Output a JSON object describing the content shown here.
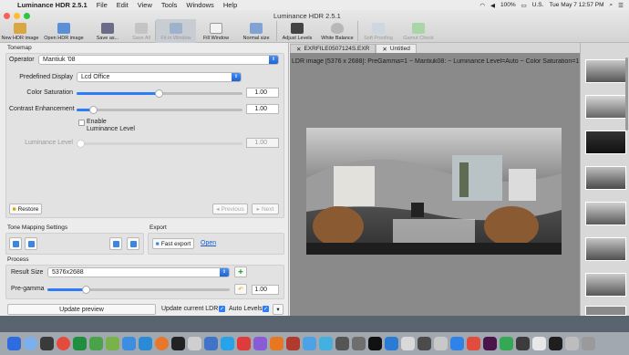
{
  "menubar": {
    "app": "Luminance HDR 2.5.1",
    "items": [
      "File",
      "Edit",
      "View",
      "Tools",
      "Windows",
      "Help"
    ],
    "battery": "100%",
    "locale": "U.S.",
    "clock": "Tue May 7  12:57 PM"
  },
  "window": {
    "title": "Luminance HDR 2.5.1"
  },
  "toolbar": [
    {
      "label": "New HDR image",
      "icon": "new-hdr-icon",
      "enabled": true
    },
    {
      "label": "Open HDR image",
      "icon": "open-folder-icon",
      "enabled": true
    },
    {
      "label": "Save as...",
      "icon": "save-icon",
      "enabled": true
    },
    {
      "label": "Save All",
      "icon": "save-all-icon",
      "enabled": false
    },
    {
      "label": "Fit in Window",
      "icon": "zoom-fit-icon",
      "enabled": false
    },
    {
      "label": "Fill Window",
      "icon": "fill-window-icon",
      "enabled": true
    },
    {
      "label": "Normal size",
      "icon": "normal-size-icon",
      "enabled": true
    },
    {
      "label": "Adjust Levels",
      "icon": "levels-icon",
      "enabled": true
    },
    {
      "label": "White Balance",
      "icon": "white-balance-icon",
      "enabled": true
    },
    {
      "label": "Soft Proofing",
      "icon": "soft-proof-icon",
      "enabled": false
    },
    {
      "label": "Gamut Check",
      "icon": "gamut-check-icon",
      "enabled": false
    }
  ],
  "tonemap": {
    "section": "Tonemap",
    "operator_label": "Operator",
    "operator": "Mantiuk '08",
    "predefined_label": "Predefined Display",
    "predefined": "Lcd Office",
    "color_saturation_label": "Color Saturation",
    "color_saturation": "1.00",
    "contrast_label": "Contrast Enhancement",
    "contrast": "1.00",
    "enable_luminance_label": "Enable\nLuminance Level",
    "luminance_label": "Luminance Level",
    "luminance": "1.00",
    "restore": "Restore",
    "previous": "Previous",
    "next": "Next"
  },
  "settings": {
    "section": "Tone Mapping Settings",
    "export_section": "Export",
    "fast_export": "Fast export",
    "open_link": "Open"
  },
  "process": {
    "section": "Process",
    "result_size_label": "Result Size",
    "result_size": "5376x2688",
    "pregamma_label": "Pre-gamma",
    "pregamma": "1.00",
    "update_preview": "Update preview",
    "update_current": "Update current LDR",
    "auto_levels": "Auto Levels"
  },
  "tabs": [
    "EXRFILE0507124S.EXR",
    "Untitled"
  ],
  "viewer": {
    "info": "LDR image [5376 x 2688]: PreGamma=1 ~ Mantiuk08: ~ Luminance Level=Auto ~ Color Saturation=1"
  },
  "colors": {
    "accent": "#2f7cf6",
    "link": "#1a5fd0",
    "viewer_bg": "#8a8a8a"
  }
}
